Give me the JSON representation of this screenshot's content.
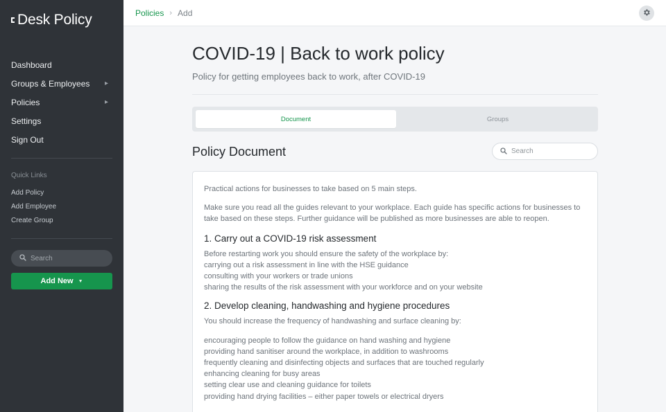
{
  "app": {
    "brand": "Desk Policy"
  },
  "sidebar": {
    "nav": [
      {
        "label": "Dashboard",
        "has_children": false
      },
      {
        "label": "Groups & Employees",
        "has_children": true
      },
      {
        "label": "Policies",
        "has_children": true
      },
      {
        "label": "Settings",
        "has_children": false
      },
      {
        "label": "Sign Out",
        "has_children": false
      }
    ],
    "quick_links_title": "Quick Links",
    "quick_links": [
      "Add Policy",
      "Add Employee",
      "Create Group"
    ],
    "search_placeholder": "Search",
    "add_new_label": "Add New"
  },
  "topbar": {
    "breadcrumb": {
      "parent": "Policies",
      "current": "Add"
    }
  },
  "page": {
    "title": "COVID-19 | Back to work policy",
    "subtitle": "Policy for getting employees back to work, after COVID-19",
    "tabs": [
      {
        "label": "Document",
        "active": true
      },
      {
        "label": "Groups",
        "active": false
      }
    ],
    "section_title": "Policy Document",
    "doc_search_placeholder": "Search"
  },
  "document": {
    "intro1": "Practical actions for businesses to take based on 5 main steps.",
    "intro2": "Make sure you read all the guides relevant to your workplace. Each guide has specific actions for businesses to take based on these steps. Further guidance will be published as more businesses are able to reopen.",
    "s1_heading": "1. Carry out a COVID-19 risk assessment",
    "s1_lines": [
      "Before restarting work you should ensure the safety of the workplace by:",
      "carrying out a risk assessment in line with the HSE guidance",
      "consulting with your workers or trade unions",
      "sharing the results of the risk assessment with your workforce and on your website"
    ],
    "s2_heading": "2. Develop cleaning, handwashing and hygiene procedures",
    "s2_intro": "You should increase the frequency of handwashing and surface cleaning by:",
    "s2_lines": [
      "encouraging people to follow the guidance on hand washing and hygiene",
      "providing hand sanitiser around the workplace, in addition to washrooms",
      "frequently cleaning and disinfecting objects and surfaces that are touched regularly",
      "enhancing cleaning for busy areas",
      "setting clear use and cleaning guidance for toilets",
      "providing hand drying facilities – either paper towels or electrical dryers"
    ]
  },
  "colors": {
    "accent": "#16954d",
    "sidebar_bg": "#2f3338",
    "page_bg": "#f5f6f8"
  },
  "icons": {
    "gear": "gear-icon",
    "search": "search-icon",
    "chevron": "chevron-right-icon",
    "caret": "caret-down-icon"
  }
}
